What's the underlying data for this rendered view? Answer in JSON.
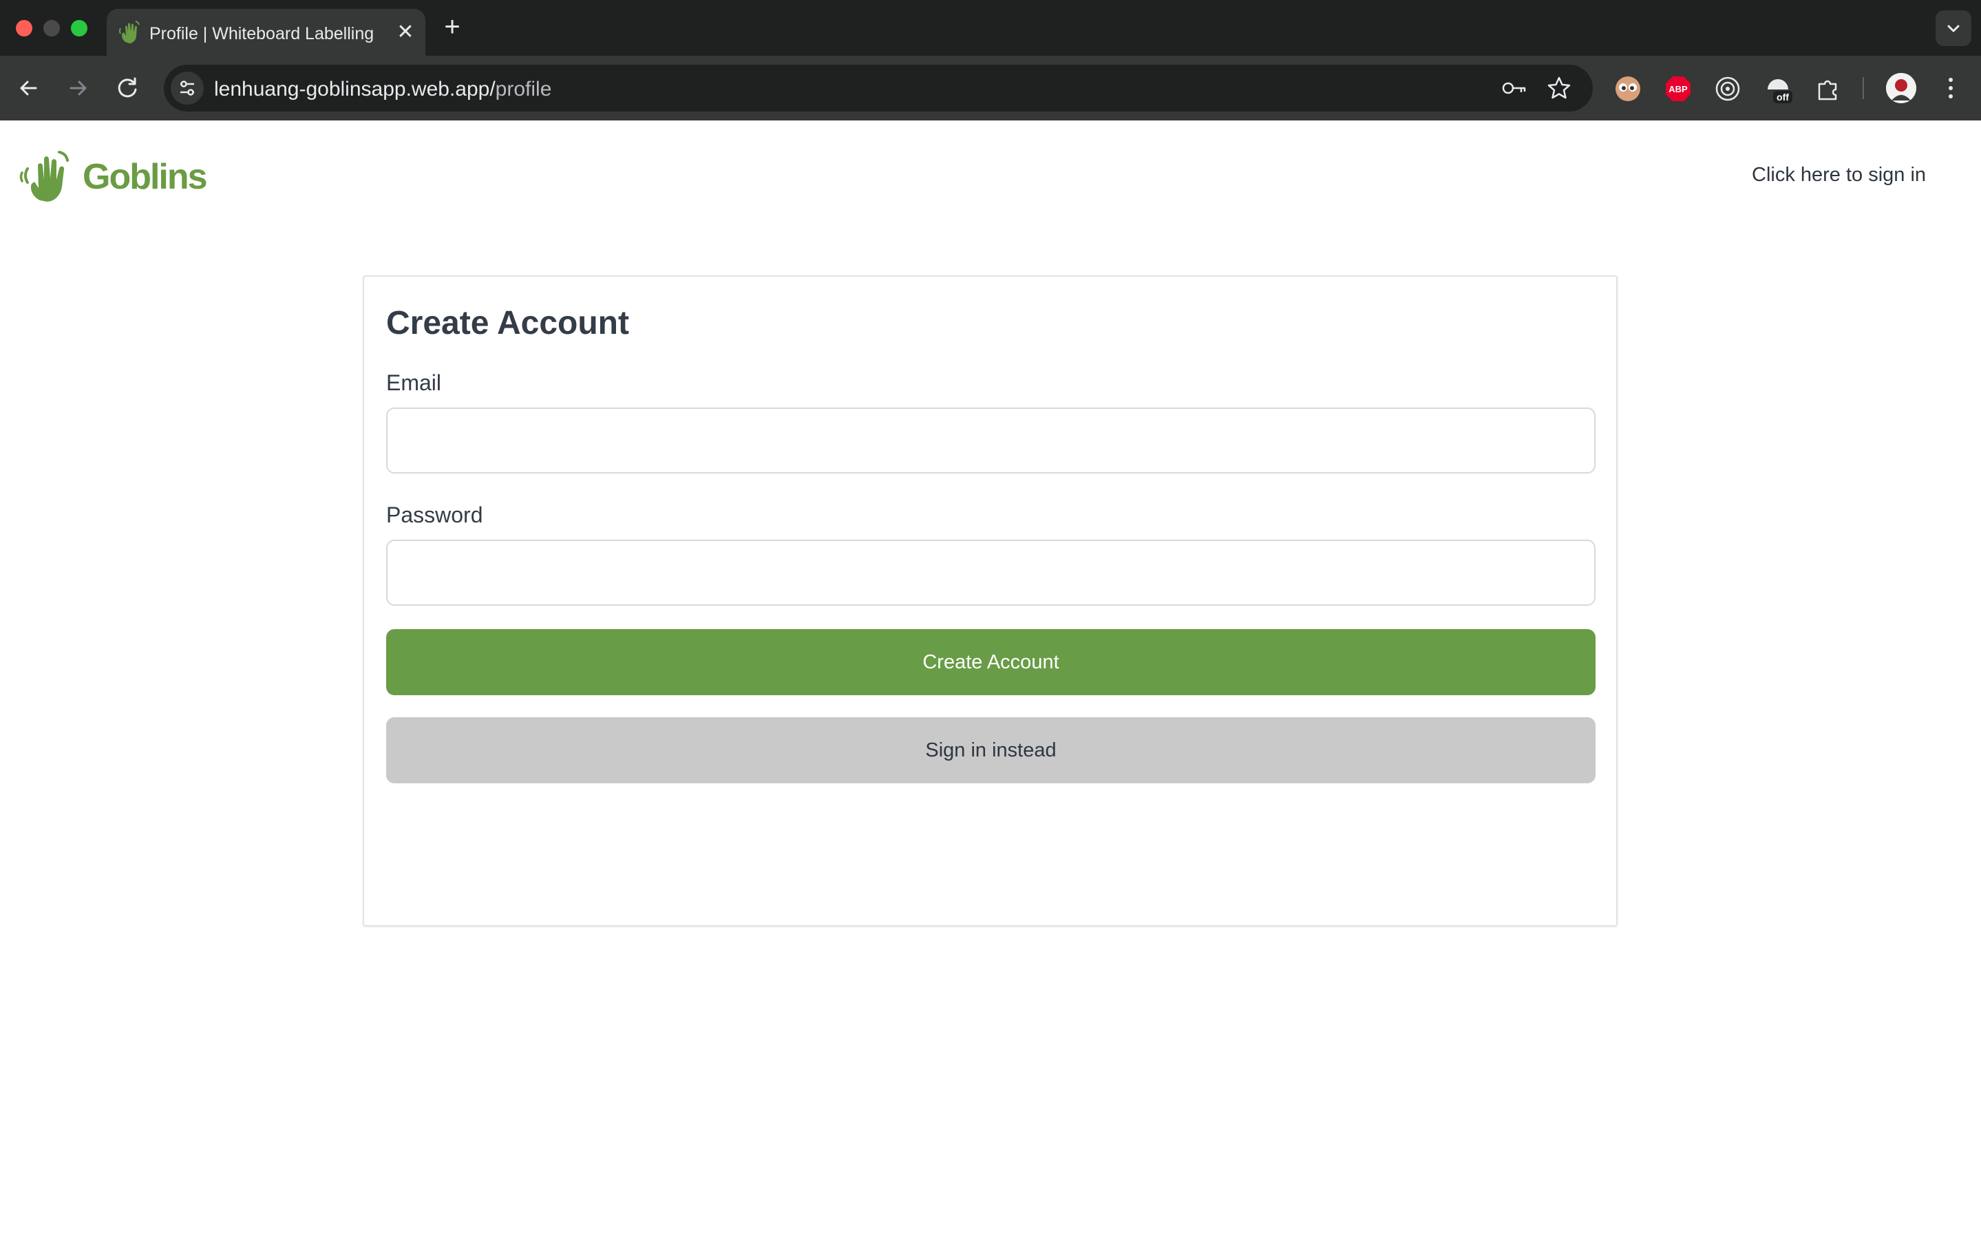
{
  "browser": {
    "tab_title": "Profile | Whiteboard Labelling",
    "tab_close_glyph": "✕",
    "new_tab_glyph": "+",
    "url_host": "lenhuang-goblinsapp.web.app/",
    "url_path": "profile",
    "extensions": [
      "eyes-extension-icon",
      "adblock-plus-icon",
      "target-extension-icon",
      "off-extension-icon",
      "puzzle-extensions-icon"
    ]
  },
  "header": {
    "brand": "Goblins",
    "signin_link": "Click here to sign in",
    "brand_color": "#6a9c44"
  },
  "form": {
    "title": "Create Account",
    "email_label": "Email",
    "email_value": "",
    "password_label": "Password",
    "password_value": "",
    "create_button": "Create Account",
    "signin_button": "Sign in instead",
    "primary_color": "#689c46",
    "secondary_color": "#c9c9c9"
  }
}
